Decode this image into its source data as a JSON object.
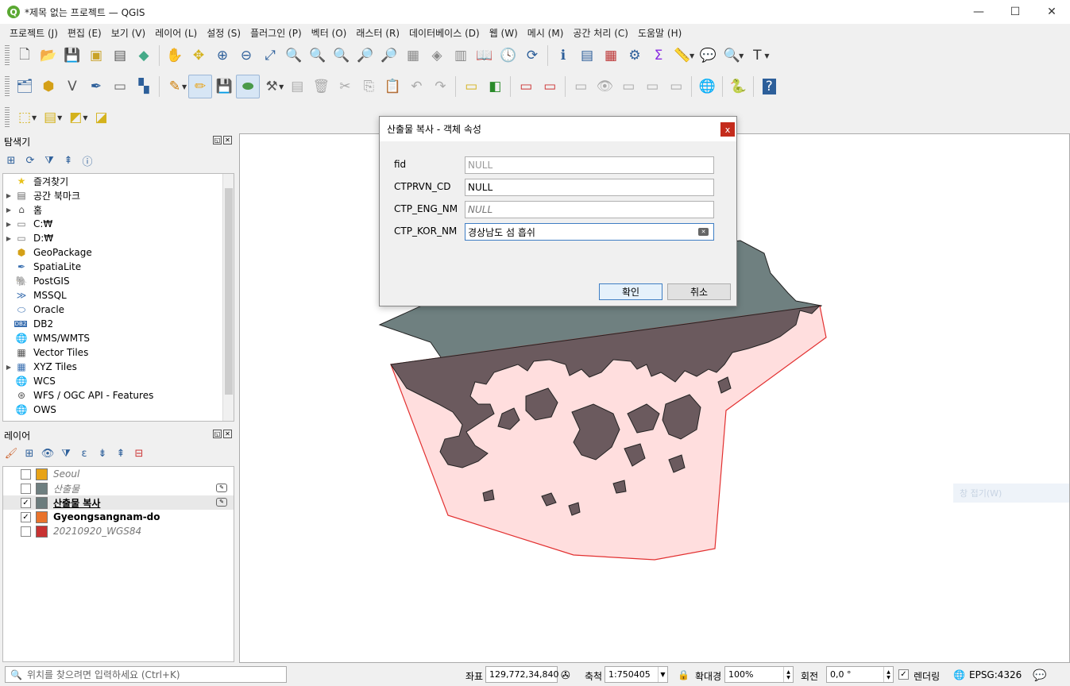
{
  "window": {
    "title": "*제목 없는 프로젝트 — QGIS",
    "logo": "Q",
    "minimize": "—",
    "maximize": "☐",
    "close": "✕"
  },
  "menu": [
    "프로젝트 (J)",
    "편집 (E)",
    "보기 (V)",
    "레이어 (L)",
    "설정 (S)",
    "플러그인 (P)",
    "벡터 (O)",
    "래스터 (R)",
    "데이터베이스 (D)",
    "웹 (W)",
    "메시 (M)",
    "공간 처리 (C)",
    "도움말 (H)"
  ],
  "browser": {
    "title": "탐색기",
    "items": [
      {
        "label": "즐겨찾기",
        "icon": "star-icon",
        "expandable": false
      },
      {
        "label": "공간 북마크",
        "icon": "bookmark-icon",
        "expandable": true
      },
      {
        "label": "홈",
        "icon": "home-folder-icon",
        "expandable": true
      },
      {
        "label": "C:₩",
        "icon": "folder-icon",
        "expandable": true
      },
      {
        "label": "D:₩",
        "icon": "folder-icon",
        "expandable": true
      },
      {
        "label": "GeoPackage",
        "icon": "geopackage-icon",
        "expandable": false
      },
      {
        "label": "SpatiaLite",
        "icon": "spatialite-icon",
        "expandable": false
      },
      {
        "label": "PostGIS",
        "icon": "postgis-icon",
        "expandable": false
      },
      {
        "label": "MSSQL",
        "icon": "mssql-icon",
        "expandable": false
      },
      {
        "label": "Oracle",
        "icon": "oracle-icon",
        "expandable": false
      },
      {
        "label": "DB2",
        "icon": "db2-icon",
        "expandable": false
      },
      {
        "label": "WMS/WMTS",
        "icon": "globe-icon",
        "expandable": false
      },
      {
        "label": "Vector Tiles",
        "icon": "grid-icon",
        "expandable": false
      },
      {
        "label": "XYZ Tiles",
        "icon": "grid-icon",
        "expandable": true
      },
      {
        "label": "WCS",
        "icon": "globe-icon",
        "expandable": false
      },
      {
        "label": "WFS / OGC API - Features",
        "icon": "wfs-icon",
        "expandable": false
      },
      {
        "label": "OWS",
        "icon": "globe-icon",
        "expandable": false
      }
    ]
  },
  "layers": {
    "title": "레이어",
    "items": [
      {
        "name": "Seoul",
        "checked": false,
        "color": "#e8a317",
        "style": "italic",
        "editing": false
      },
      {
        "name": "산출물",
        "checked": false,
        "color": "#6e7f80",
        "style": "italic",
        "editing": true
      },
      {
        "name": "산출물 복사",
        "checked": true,
        "color": "#6b7c7d",
        "style": "bold-underline",
        "editing": true
      },
      {
        "name": "Gyeongsangnam-do",
        "checked": true,
        "color": "#e9732c",
        "style": "bold",
        "editing": false
      },
      {
        "name": "20210920_WGS84",
        "checked": false,
        "color": "#c83232",
        "style": "italic",
        "editing": false
      }
    ]
  },
  "dialog": {
    "title": "산출물 복사 - 객체 속성",
    "close": "x",
    "fields": [
      {
        "label": "fid",
        "value": "NULL",
        "kind": "null"
      },
      {
        "label": "CTPRVN_CD",
        "value": "NULL",
        "kind": "normal"
      },
      {
        "label": "CTP_ENG_NM",
        "value": "NULL",
        "kind": "italic"
      },
      {
        "label": "CTP_KOR_NM",
        "value": "경상남도 섬 흡쉬",
        "kind": "focus"
      }
    ],
    "ok": "확인",
    "cancel": "취소"
  },
  "map": {
    "ghost_text": "창 접기(W)",
    "colors": {
      "land": "#6b5a5e",
      "upper": "#6f8080",
      "highlight": "#ffdede",
      "outline": "#e23030"
    }
  },
  "status": {
    "locator_placeholder": "위치를 찾으려면 입력하세요 (Ctrl+K)",
    "coord_label": "좌표",
    "coord_value": "129,772,34,840",
    "scale_label": "축척",
    "scale_value": "1:750405",
    "magnifier_label": "확대경",
    "magnifier_value": "100%",
    "rotation_label": "회전",
    "rotation_value": "0,0 °",
    "render_label": "렌더링",
    "crs": "EPSG:4326"
  }
}
